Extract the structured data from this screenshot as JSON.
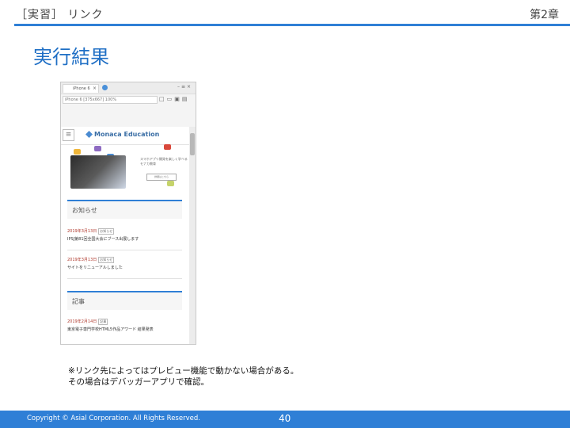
{
  "header": {
    "section_label": "［実習］ リンク",
    "chapter_label": "第2章"
  },
  "slide": {
    "title": "実行結果"
  },
  "browser": {
    "tab_title": "iPhone 6",
    "address": "iPhone 6 [375x667] 100%",
    "site": {
      "logo": "Monaca Education",
      "hero_text": "スマホアプリ開発を楽しく学べるモナカ教育",
      "hero_button": "詳細はこちら",
      "news_heading": "お知らせ",
      "news": [
        {
          "date": "2019年3月13日",
          "tag": "お知らせ",
          "title": "IPSJ第81回全国大会にブース出展します"
        },
        {
          "date": "2019年3月13日",
          "tag": "お知らせ",
          "title": "サイトをリニューアルしました"
        }
      ],
      "articles_heading": "記事",
      "articles": [
        {
          "date": "2019年2月14日",
          "tag": "記事",
          "title": "東京電子専門学校HTML5作品アワード 結果発表"
        }
      ]
    }
  },
  "note": {
    "line1": "※リンク先によってはプレビュー機能で動かない場合がある。",
    "line2": "その場合はデバッガーアプリで確認。"
  },
  "footer": {
    "copyright": "Copyright © Asial Corporation. All Rights Reserved.",
    "page_number": "40"
  },
  "colors": {
    "accent": "#2f7fd6",
    "title": "#1f6fc5",
    "date_red": "#b03a2e"
  }
}
